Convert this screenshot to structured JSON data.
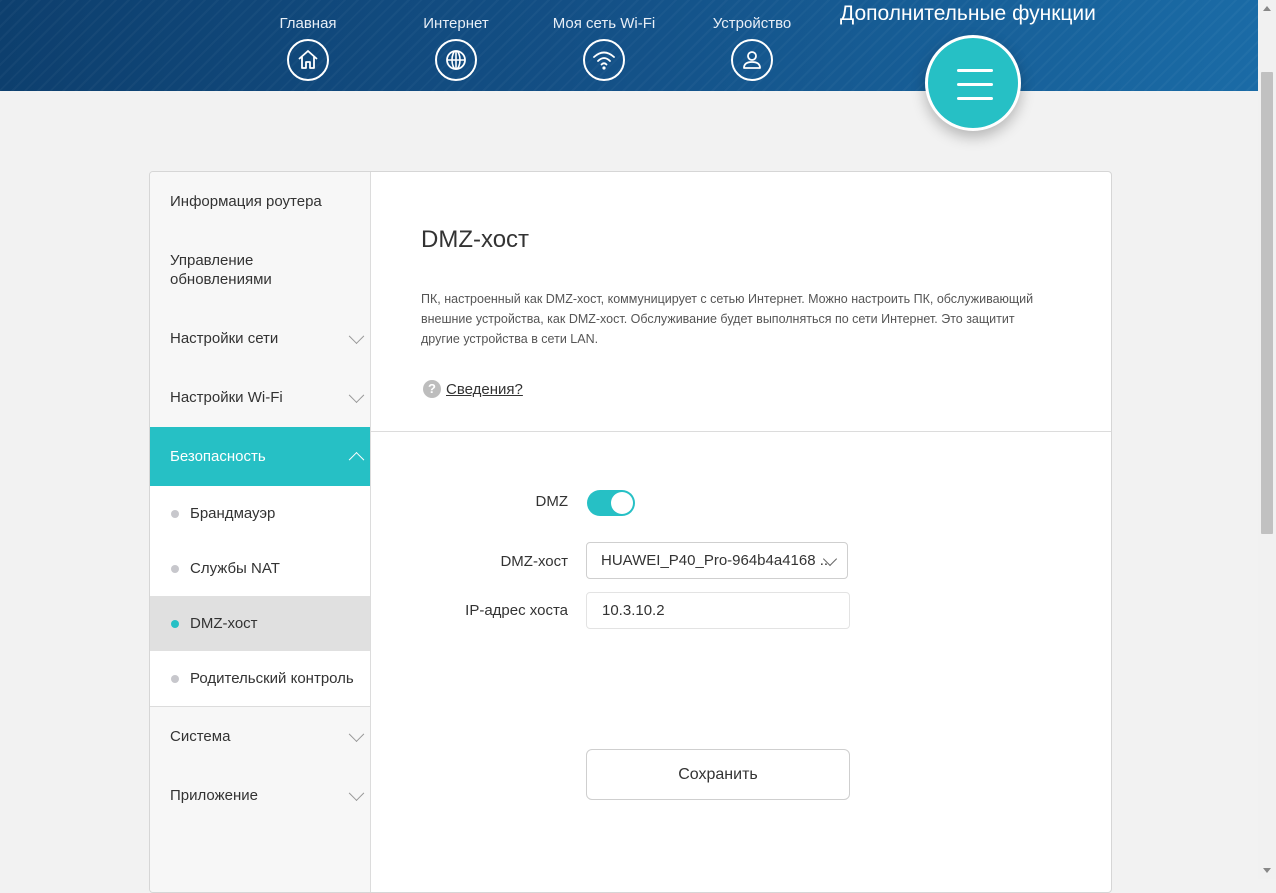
{
  "header": {
    "nav": [
      {
        "label": "Главная",
        "icon": "home-icon"
      },
      {
        "label": "Интернет",
        "icon": "globe-icon"
      },
      {
        "label": "Моя сеть Wi-Fi",
        "icon": "wifi-icon"
      },
      {
        "label": "Устройство",
        "icon": "user-icon"
      }
    ],
    "active_label": "Дополнительные функции",
    "active_icon": "menu-icon"
  },
  "sidebar": {
    "items_top": [
      {
        "label": "Информация роутера"
      },
      {
        "label": "Управление обновлениями"
      },
      {
        "label": "Настройки сети"
      },
      {
        "label": "Настройки Wi-Fi"
      }
    ],
    "active_section": {
      "label": "Безопасность"
    },
    "sub_items": [
      {
        "label": "Брандмауэр"
      },
      {
        "label": "Службы NAT"
      },
      {
        "label": "DMZ-хост"
      },
      {
        "label": "Родительский контроль"
      }
    ],
    "items_bottom": [
      {
        "label": "Система"
      },
      {
        "label": "Приложение"
      }
    ]
  },
  "content": {
    "title": "DMZ-хост",
    "description": "ПК, настроенный как DMZ-хост, коммуницирует с сетью Интернет. Можно настроить ПК, обслуживающий внешние устройства, как DMZ-хост. Обслуживание будет выполняться по сети Интернет. Это защитит другие устройства в сети LAN.",
    "help_link": "Сведения?",
    "form": {
      "dmz_label": "DMZ",
      "dmz_enabled": true,
      "host_label": "DMZ-хост",
      "host_value": "HUAWEI_P40_Pro-964b4a4168 ...",
      "ip_label": "IP-адрес хоста",
      "ip_value": "10.3.10.2"
    },
    "save_label": "Сохранить"
  },
  "colors": {
    "accent": "#26c0c5",
    "header_dark": "#0d3f6e",
    "header_light": "#1a6ba6"
  }
}
